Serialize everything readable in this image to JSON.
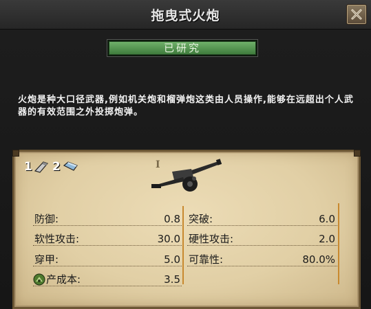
{
  "window": {
    "title": "拖曳式火炮"
  },
  "status": {
    "label": "已研究"
  },
  "description": "火炮是种大口径武器,例如机关炮和榴弹炮这类由人员操作,能够在远超出个人武器的有效范围之外投掷炮弹。",
  "unit": {
    "tier": "I",
    "icon": "artillery-gun-icon"
  },
  "equipment": [
    {
      "count": "1",
      "icon": "infantry-equipment-icon"
    },
    {
      "count": "2",
      "icon": "support-equipment-icon"
    }
  ],
  "stats_left": [
    {
      "label": "防御:",
      "value": "0.8"
    },
    {
      "label": "软性攻击:",
      "value": "30.0"
    },
    {
      "label": "穿甲:",
      "value": "5.0"
    },
    {
      "label": "产成本:",
      "value": "3.5",
      "icon": "production-cost-icon"
    }
  ],
  "stats_right": [
    {
      "label": "突破:",
      "value": "6.0"
    },
    {
      "label": "硬性攻击:",
      "value": "2.0"
    },
    {
      "label": "可靠性:",
      "value": "80.0%"
    }
  ],
  "colors": {
    "status_green": "#4f934b",
    "parchment": "#e6d4ab",
    "divider_orange": "#c8892f",
    "window_bg": "#1b1b1b"
  }
}
